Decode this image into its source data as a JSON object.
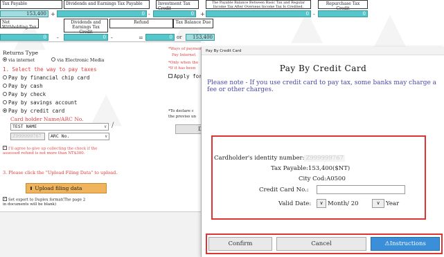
{
  "top_table": {
    "row1_headers": [
      "Tax Payable",
      "Dividends and Earnings Tax Payable",
      "Investment Tax Credit",
      "The Payable Balance Between Basic Tax and Regular Income Tax After Overseas Income Tax Is Credited.",
      "Repurchase Tax Credit"
    ],
    "row1_values": [
      "153,400",
      "0",
      "0",
      "0",
      "0"
    ],
    "row1_ops": [
      "+",
      "-",
      "+",
      "-"
    ],
    "row2_headers": [
      "Net Withholding Tax",
      "Dividends and Earnings Tax Credit",
      "Refund",
      "Tax Balance Due"
    ],
    "row2_values": [
      "0",
      "0",
      "0",
      "153,400"
    ],
    "row2_ops": [
      "-",
      "-",
      "=",
      "or"
    ]
  },
  "left_panel": {
    "returns_type_label": "Returns Type",
    "returns_options": [
      "via internet",
      "via Electronic Media"
    ],
    "step1_label": "1. Select the way to pay taxes",
    "pay_options": [
      "Pay by financial chip card",
      "Pay by cash",
      "Pay by check",
      "Pay by savings account",
      "Pay by credit card"
    ],
    "holder_label": "Card holder Name/ARC No.",
    "holder_name": "TEST NAME",
    "holder_id": "Z999999767",
    "arc_select": "ARC No.",
    "step2_text": "I'll agree to give up collecting the check if the assessed refund is not more than NT$300.",
    "step3_text": "3. Please click the \"Upload Filing Data\" to upload.",
    "upload_label": "Upload filing data",
    "export_text": "Set export to Duplex format(The page 2 in documents will be blank)"
  },
  "middle_col": {
    "line1": "*Ways of paymen",
    "line2": "Pay Internet",
    "line3": "*Only when the",
    "line4": "*If it has been",
    "apply_label": "Apply for",
    "note1": "*To declare c",
    "note2": "the proviso un",
    "btn_label": "D"
  },
  "modal": {
    "window_title": "Pay By Credit Card",
    "heading": "Pay By Credit Card",
    "notice": "Please note - If you use credit card to pay tax, some banks may charge a fee or other charges.",
    "id_label": "Cardholder's identity number:",
    "id_value": "Z999999767",
    "tax_label": "Tax Payable:",
    "tax_value": "153,400($NT)",
    "city_label": "City Cod:",
    "city_value": "A0500",
    "card_label": "Credit Card No.:",
    "card_value": "",
    "valid_label": "Valid Date:",
    "month_label": "Month/ 20",
    "year_label": "Year",
    "confirm_label": "Confirm",
    "cancel_label": "Cancel",
    "instructions_label": "Instructions"
  },
  "colors": {
    "accent_teal": "#55c6c9",
    "alert_red": "#d33333",
    "notice_blue": "#4a4aa8",
    "upload_orange": "#f0b45c",
    "instructions_blue": "#3a8fd8"
  }
}
